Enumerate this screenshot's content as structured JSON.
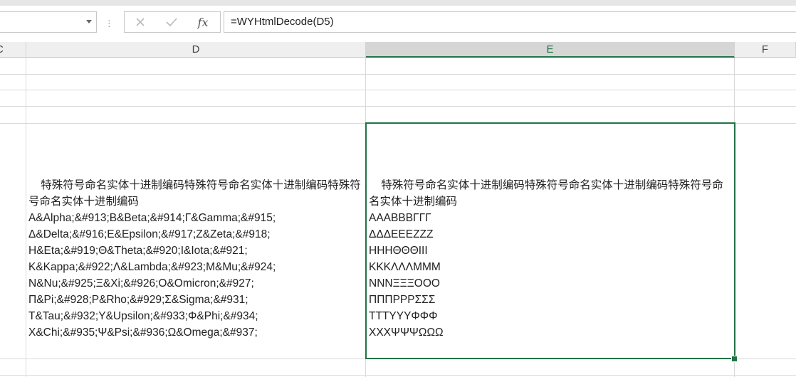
{
  "formula_bar": {
    "formula": "=WYHtmlDecode(D5)",
    "fx_label": "fx"
  },
  "columns": [
    {
      "label": "C"
    },
    {
      "label": "D"
    },
    {
      "label": "E"
    },
    {
      "label": "F"
    }
  ],
  "cells": {
    "D5": "特殊符号命名实体十进制编码特殊符号命名实体十进制编码特殊符号命名实体十进制编码\nA&Alpha;&#913;B&Beta;&#914;Γ&Gamma;&#915;\nΔ&Delta;&#916;E&Epsilon;&#917;Z&Zeta;&#918;\nH&Eta;&#919;Θ&Theta;&#920;I&Iota;&#921;\nK&Kappa;&#922;Λ&Lambda;&#923;M&Mu;&#924;\nN&Nu;&#925;Ξ&Xi;&#926;O&Omicron;&#927;\nΠ&Pi;&#928;P&Rho;&#929;Σ&Sigma;&#931;\nT&Tau;&#932;Y&Upsilon;&#933;Φ&Phi;&#934;\nX&Chi;&#935;Ψ&Psi;&#936;Ω&Omega;&#937;",
    "E5": "特殊符号命名实体十进制编码特殊符号命名实体十进制编码特殊符号命名实体十进制编码\nAAABBBΓΓΓ\nΔΔΔEEEZZZ\nHHHΘΘΘIII\nKKKΛΛΛMMM\nNNNΞΞΞOOO\nΠΠΠPPPΣΣΣ\nTTTYYYΦΦΦ\nXXXΨΨΨΩΩΩ"
  },
  "icons": {
    "cancel": "close-icon",
    "confirm": "check-icon",
    "function": "fx-icon"
  },
  "colors": {
    "accent": "#217346"
  }
}
